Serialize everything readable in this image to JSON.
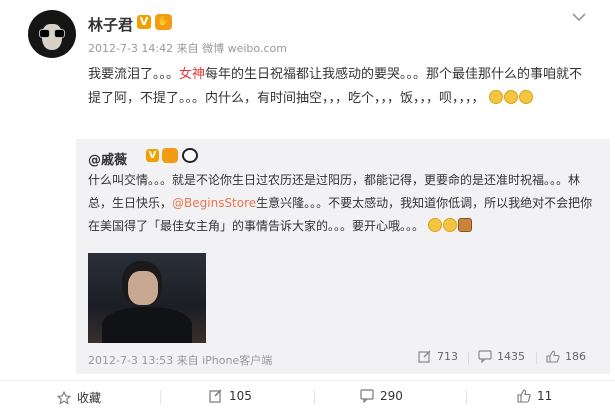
{
  "post": {
    "author": "林子君",
    "verified_badge": "V",
    "meta": "2012-7-3 14:42 来自 微博 weibo.com",
    "text_part1": "我要流泪了。。。",
    "text_highlight": "女神",
    "text_part2": "每年的生日祝福都让我感动的要哭。。。那个最佳那什么的事咱就不提了阿，不提了。。。内什么，有时间抽空，，，吃个，，，饭，，，呗，，，，"
  },
  "repost": {
    "author": "@戚薇",
    "verified_badge": "V",
    "text_part1": "什么叫交情。。。就是不论你生日过农历还是过阳历，都能记得，更要命的是还准时祝福。。。林总，生日快乐，",
    "mention": "@BeginsStore",
    "text_part2": "生意兴隆。。。不要太感动，我知道你低调，所以我绝对不会把你在美国得了「最佳女主角」的事情告诉大家的。。。要开心哦。。。",
    "meta": "2012-7-3 13:53 来自 iPhone客户端",
    "reposts": "713",
    "comments": "1435",
    "likes": "186"
  },
  "actions": {
    "favorite": "收藏",
    "repost": "105",
    "comment": "290",
    "like": "11"
  },
  "colors": {
    "accent_red": "#e4393c",
    "link": "#eb7350",
    "quote_bg": "#f2f2f5"
  }
}
